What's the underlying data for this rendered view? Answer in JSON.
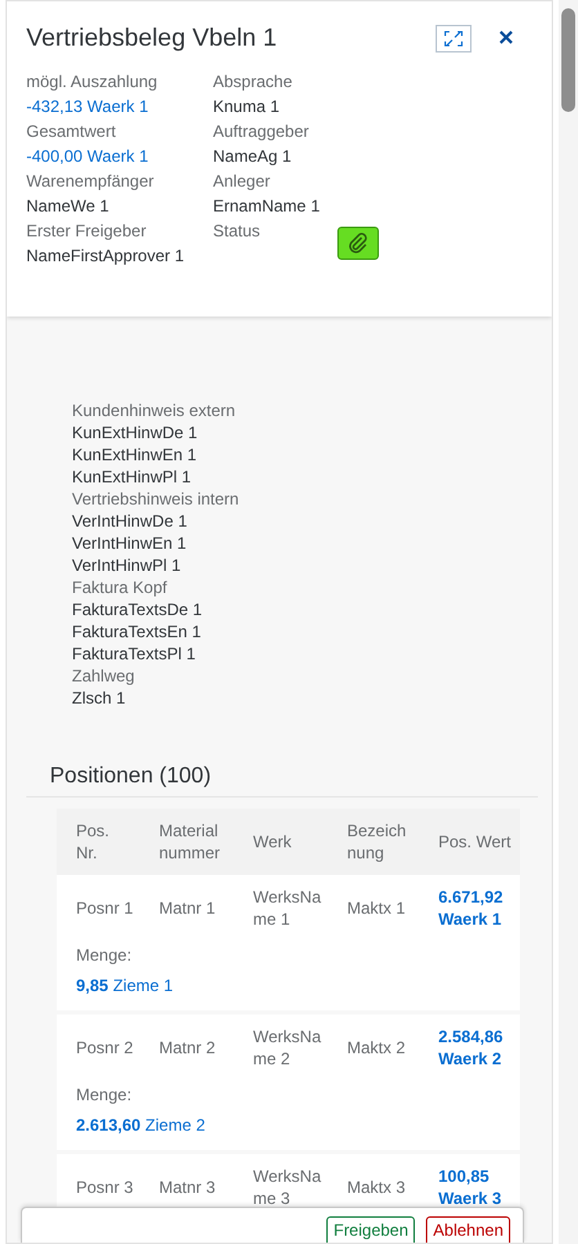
{
  "header": {
    "title": "Vertriebsbeleg Vbeln 1",
    "fields": [
      {
        "label": "mögl. Auszahlung",
        "value": "-432,13 Waerk 1",
        "kind": "link"
      },
      {
        "label": "Absprache",
        "value": "Knuma 1",
        "kind": "text"
      },
      {
        "label": "Gesamtwert",
        "value": "-400,00 Waerk 1",
        "kind": "link"
      },
      {
        "label": "Auftraggeber",
        "value": "NameAg 1",
        "kind": "text"
      },
      {
        "label": "Warenempfänger",
        "value": "NameWe 1",
        "kind": "text"
      },
      {
        "label": "Anleger",
        "value": "ErnamName 1",
        "kind": "text"
      },
      {
        "label": "Erster Freigeber",
        "value": "NameFirstApprover 1",
        "kind": "text"
      },
      {
        "label": "Status",
        "kind": "attachment"
      }
    ]
  },
  "notes": [
    {
      "label": "Kundenhinweis extern",
      "values": [
        "KunExtHinwDe 1",
        "KunExtHinwEn 1",
        "KunExtHinwPl 1"
      ]
    },
    {
      "label": "Vertriebshinweis intern",
      "values": [
        "VerIntHinwDe 1",
        "VerIntHinwEn 1",
        "VerIntHinwPl 1"
      ]
    },
    {
      "label": "Faktura Kopf",
      "values": [
        "FakturaTextsDe 1",
        "FakturaTextsEn 1",
        "FakturaTextsPl 1"
      ]
    },
    {
      "label": "Zahlweg",
      "values": [
        "Zlsch 1"
      ]
    }
  ],
  "positions": {
    "title": "Positionen (100)",
    "columns": [
      "Pos. Nr.",
      "Material nummer",
      "Werk",
      "Bezeich nung",
      "Pos. Wert"
    ],
    "rows": [
      {
        "posnr": "Posnr 1",
        "matnr": "Matnr 1",
        "werk": "WerksName 1",
        "maktx": "Maktx 1",
        "wert": "6.671,92 Waerk 1",
        "menge_label": "Menge:",
        "menge": "**9,85** Zieme 1"
      },
      {
        "posnr": "Posnr 2",
        "matnr": "Matnr 2",
        "werk": "WerksName 2",
        "maktx": "Maktx 2",
        "wert": "2.584,86 Waerk 2",
        "menge_label": "Menge:",
        "menge": "**2.613,60** Zieme 2"
      },
      {
        "posnr": "Posnr 3",
        "matnr": "Matnr 3",
        "werk": "WerksName 3",
        "maktx": "Maktx 3",
        "wert": "100,85 Waerk 3"
      }
    ]
  },
  "footer": {
    "buttons": [
      {
        "label": "Freigeben",
        "kind": "accept"
      },
      {
        "label": "Ablehnen",
        "kind": "reject"
      }
    ]
  }
}
